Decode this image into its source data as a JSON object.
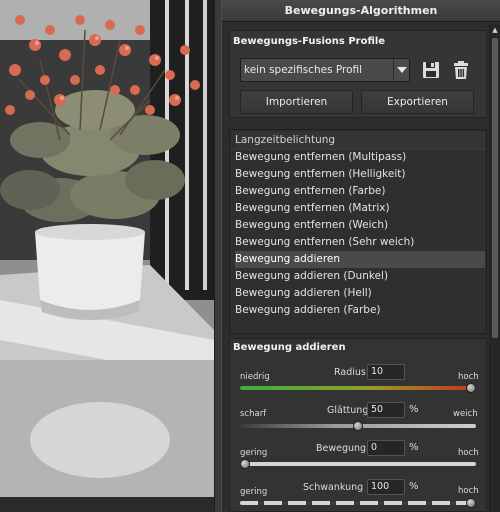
{
  "panel": {
    "title": "Bewegungs-Algorithmen"
  },
  "profiles": {
    "heading": "Bewegungs-Fusions Profile",
    "selected_profile": "kein spezifisches Profil",
    "save_icon": "save-icon",
    "delete_icon": "trash-icon",
    "import_label": "Importieren",
    "export_label": "Exportieren"
  },
  "algorithms": {
    "header": "Langzeitbelichtung",
    "items": [
      "Bewegung entfernen (Multipass)",
      "Bewegung entfernen (Helligkeit)",
      "Bewegung entfernen (Farbe)",
      "Bewegung entfernen (Matrix)",
      "Bewegung entfernen (Weich)",
      "Bewegung entfernen (Sehr weich)",
      "Bewegung addieren",
      "Bewegung addieren (Dunkel)",
      "Bewegung addieren (Hell)",
      "Bewegung addieren (Farbe)"
    ],
    "selected_index": 6
  },
  "params": {
    "heading": "Bewegung addieren",
    "radius": {
      "name": "Radius",
      "value": "10",
      "min_label": "niedrig",
      "max_label": "hoch",
      "level": 1.0
    },
    "glaettung": {
      "name": "Glättung",
      "value": "50",
      "unit": "%",
      "min_label": "scharf",
      "max_label": "weich",
      "level": 0.5
    },
    "bewegung": {
      "name": "Bewegung",
      "value": "0",
      "unit": "%",
      "min_label": "gering",
      "max_label": "hoch",
      "level": 0.0
    },
    "schwankung": {
      "name": "Schwankung",
      "value": "100",
      "unit": "%",
      "min_label": "gering",
      "max_label": "hoch",
      "level": 1.0
    }
  },
  "colors": {
    "panel_bg": "#2d2d2d",
    "accent_green": "#3fae3f",
    "accent_red": "#c8321e",
    "selection": "#4a4a4a"
  }
}
